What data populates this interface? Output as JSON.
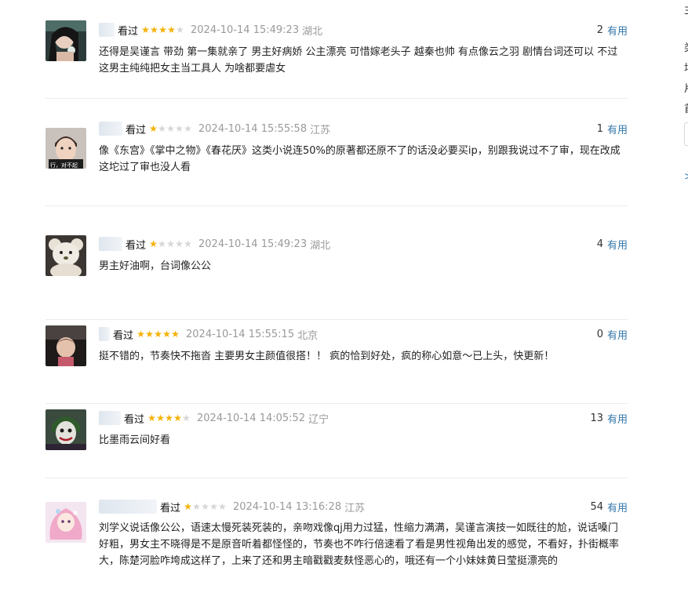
{
  "reviews": [
    {
      "status": "看过",
      "rating": 4,
      "time": "2024-10-14 15:49:23",
      "location": "湖北",
      "votes": "2",
      "useful_label": "有用",
      "content": "还得是吴谨言 带劲 第一集就亲了 男主好病娇 公主漂亮 可惜嫁老头子 越秦也帅 有点像云之羽 剧情台词还可以 不过这男主纯纯把女主当工具人 为啥都要虐女"
    },
    {
      "status": "看过",
      "rating": 1,
      "time": "2024-10-14 15:55:58",
      "location": "江苏",
      "votes": "1",
      "useful_label": "有用",
      "content": "像《东宫》《掌中之物》《春花厌》这类小说连50%的原著都还原不了的话没必要买ip，别跟我说过不了审，现在改成这坨过了审也没人看"
    },
    {
      "status": "看过",
      "rating": 1,
      "time": "2024-10-14 15:49:23",
      "location": "湖北",
      "votes": "4",
      "useful_label": "有用",
      "content": "男主好油啊，台词像公公"
    },
    {
      "status": "看过",
      "rating": 5,
      "time": "2024-10-14 15:55:15",
      "location": "北京",
      "votes": "0",
      "useful_label": "有用",
      "content": "挺不错的，节奏快不拖沓 主要男女主颜值很搭！！ 疯的恰到好处，疯的称心如意～已上头，快更新！"
    },
    {
      "status": "看过",
      "rating": 4,
      "time": "2024-10-14 14:05:52",
      "location": "辽宁",
      "votes": "13",
      "useful_label": "有用",
      "content": "比墨雨云间好看"
    },
    {
      "status": "看过",
      "rating": 1,
      "time": "2024-10-14 13:16:28",
      "location": "江苏",
      "votes": "54",
      "useful_label": "有用",
      "content": "刘学义说话像公公，语速太慢死装死装的，亲吻戏像qj用力过猛，性缩力满满，吴谨言演技一如既往的尬，说话嗓门好粗，男女主不晓得是不是原音听着都怪怪的，节奏也不咋行倍速看了看是男性视角出发的感觉，不看好，扑街概率大，陈楚河脸咋垮成这样了，上来了还和男主暗戳戳麦麸怪恶心的，哦还有一个小妹妹黄日莹挺漂亮的"
    }
  ],
  "avatars": [
    "woman-with-flower",
    "man-portrait-sticker",
    "teddy-bear",
    "child-in-car",
    "joker",
    "anime-girl-pink-hair"
  ],
  "avatar_caption_2": "行，对不起",
  "sidebar_chars": [
    "主",
    "类",
    "场",
    "片",
    "首",
    ">"
  ],
  "colors": {
    "useful": "#3377aa",
    "star_on": "#f5b100",
    "star_off": "#d6d6d6",
    "meta_gray": "#9a9a9a",
    "divider": "#ececec"
  }
}
